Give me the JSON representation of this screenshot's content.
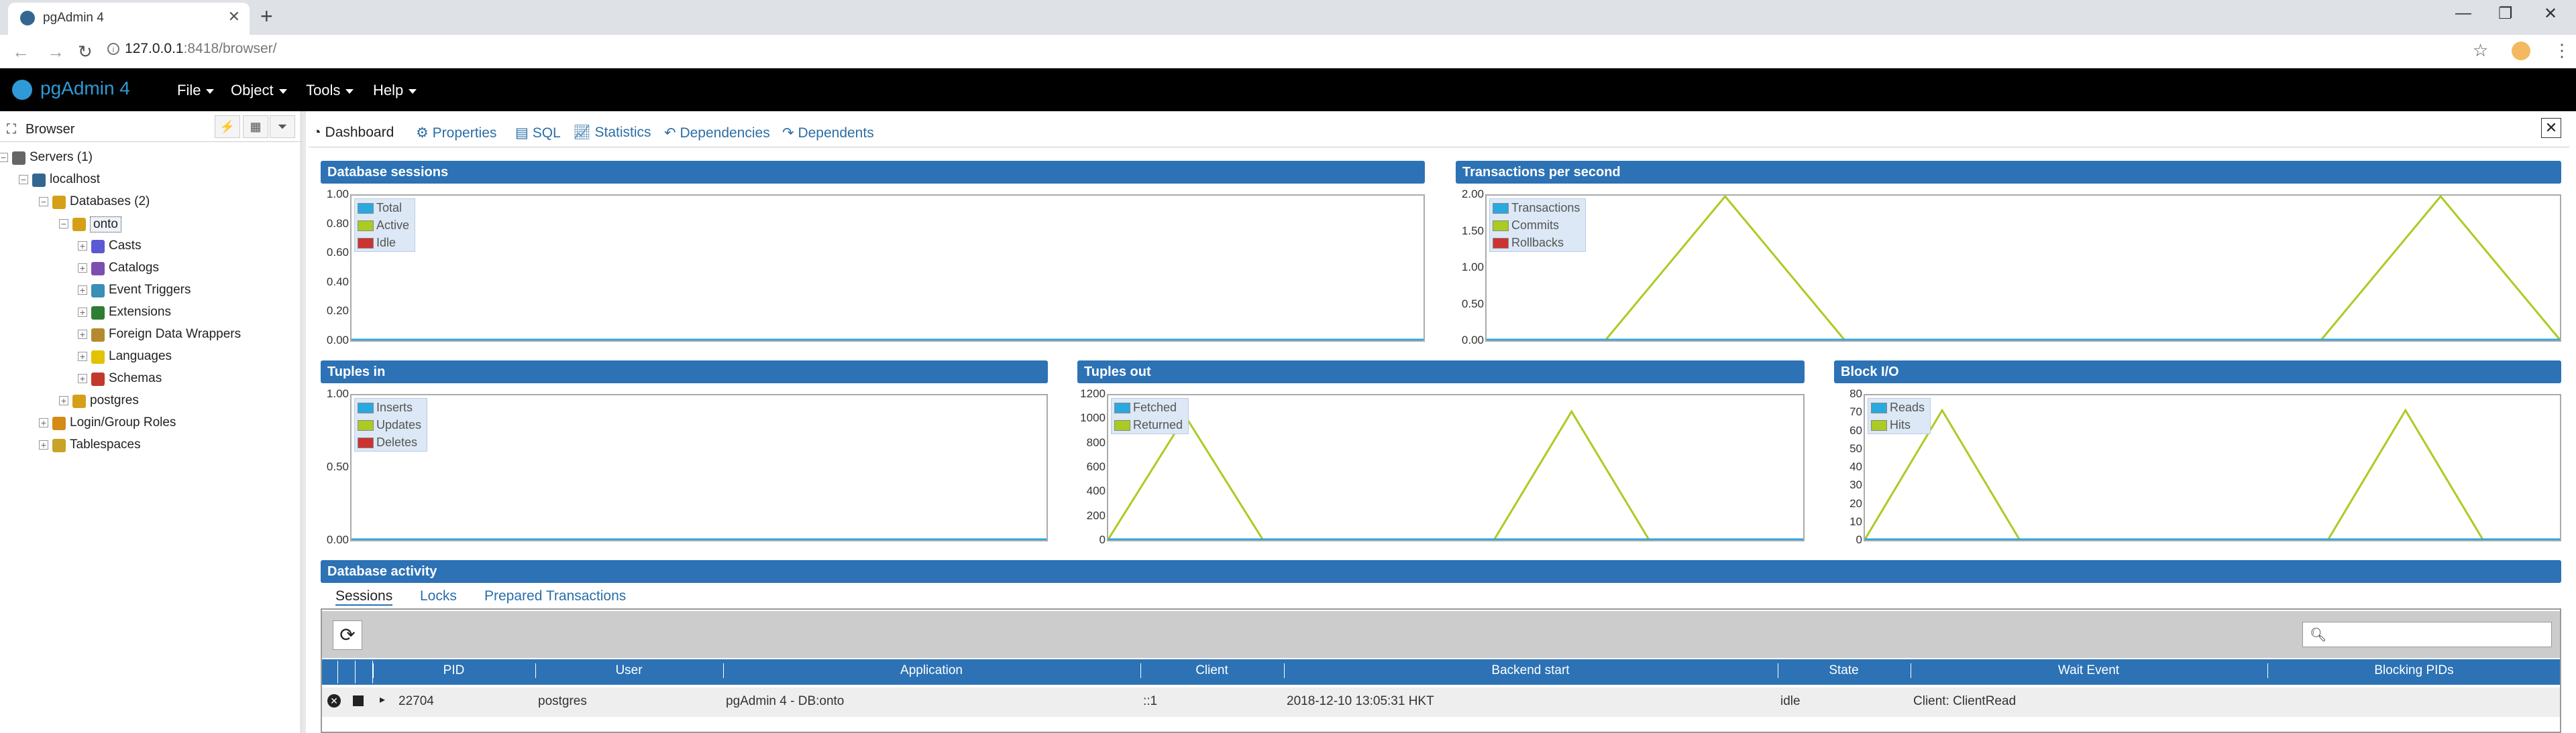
{
  "browser": {
    "tab_title": "pgAdmin 4",
    "url_host": "127.0.0.1",
    "url_rest": ":8418/browser/"
  },
  "app": {
    "brand": "pgAdmin 4",
    "menus": [
      "File",
      "Object",
      "Tools",
      "Help"
    ]
  },
  "left_panel": {
    "title": "Browser",
    "tree": [
      {
        "label": "Servers (1)",
        "icon": "servers-icon"
      },
      {
        "label": "localhost",
        "icon": "server-icon"
      },
      {
        "label": "Databases (2)",
        "icon": "databases-icon"
      },
      {
        "label": "onto",
        "icon": "database-icon"
      },
      {
        "label": "Casts",
        "icon": "casts-icon"
      },
      {
        "label": "Catalogs",
        "icon": "catalogs-icon"
      },
      {
        "label": "Event Triggers",
        "icon": "event-triggers-icon"
      },
      {
        "label": "Extensions",
        "icon": "extensions-icon"
      },
      {
        "label": "Foreign Data Wrappers",
        "icon": "fdw-icon"
      },
      {
        "label": "Languages",
        "icon": "languages-icon"
      },
      {
        "label": "Schemas",
        "icon": "schemas-icon"
      },
      {
        "label": "postgres",
        "icon": "database-icon"
      },
      {
        "label": "Login/Group Roles",
        "icon": "roles-icon"
      },
      {
        "label": "Tablespaces",
        "icon": "tablespaces-icon"
      }
    ]
  },
  "tabs": [
    "Dashboard",
    "Properties",
    "SQL",
    "Statistics",
    "Dependencies",
    "Dependents"
  ],
  "colors": {
    "header_blue": "#2c72b5",
    "series_blue": "#29a9e0",
    "series_green": "#aacc22",
    "series_red": "#cc3333"
  },
  "chart_data": [
    {
      "type": "line",
      "title": "Database sessions",
      "ylim": [
        0,
        1
      ],
      "ticks": [
        "1.00",
        "0.80",
        "0.60",
        "0.40",
        "0.20",
        "0.00"
      ],
      "series": [
        {
          "name": "Total",
          "values": [
            0,
            0,
            0,
            0,
            0,
            0,
            0,
            0,
            0,
            0
          ]
        },
        {
          "name": "Active",
          "values": [
            0,
            0,
            0,
            0,
            0,
            0,
            0,
            0,
            0,
            0
          ]
        },
        {
          "name": "Idle",
          "values": [
            0,
            0,
            0,
            0,
            0,
            0,
            0,
            0,
            0,
            0
          ]
        }
      ]
    },
    {
      "type": "line",
      "title": "Transactions per second",
      "ylim": [
        0,
        2
      ],
      "ticks": [
        "2.00",
        "1.50",
        "1.00",
        "0.50",
        "0.00"
      ],
      "series": [
        {
          "name": "Transactions",
          "values": [
            0,
            0,
            0,
            0,
            0,
            0,
            0,
            0,
            0,
            0
          ]
        },
        {
          "name": "Commits",
          "values": [
            0,
            0,
            2,
            0,
            0,
            0,
            0,
            0,
            2,
            0
          ]
        },
        {
          "name": "Rollbacks",
          "values": [
            0,
            0,
            0,
            0,
            0,
            0,
            0,
            0,
            0,
            0
          ]
        }
      ]
    },
    {
      "type": "line",
      "title": "Tuples in",
      "ylim": [
        0,
        1
      ],
      "ticks": [
        "1.00",
        "0.50",
        "0.00"
      ],
      "series": [
        {
          "name": "Inserts",
          "values": [
            0,
            0,
            0,
            0,
            0,
            0,
            0,
            0,
            0,
            0
          ]
        },
        {
          "name": "Updates",
          "values": [
            0,
            0,
            0,
            0,
            0,
            0,
            0,
            0,
            0,
            0
          ]
        },
        {
          "name": "Deletes",
          "values": [
            0,
            0,
            0,
            0,
            0,
            0,
            0,
            0,
            0,
            0
          ]
        }
      ]
    },
    {
      "type": "line",
      "title": "Tuples out",
      "ylim": [
        0,
        1200
      ],
      "ticks": [
        "1200",
        "1000",
        "800",
        "600",
        "400",
        "200",
        "0"
      ],
      "series": [
        {
          "name": "Fetched",
          "values": [
            0,
            0,
            0,
            0,
            0,
            0,
            0,
            0,
            0,
            0
          ]
        },
        {
          "name": "Returned",
          "values": [
            0,
            1030,
            0,
            0,
            0,
            0,
            1070,
            0,
            0,
            0
          ]
        }
      ]
    },
    {
      "type": "line",
      "title": "Block I/O",
      "ylim": [
        0,
        80
      ],
      "ticks": [
        "80",
        "70",
        "60",
        "50",
        "40",
        "30",
        "20",
        "10",
        "0"
      ],
      "series": [
        {
          "name": "Reads",
          "values": [
            0,
            0,
            0,
            0,
            0,
            0,
            0,
            0,
            0,
            0
          ]
        },
        {
          "name": "Hits",
          "values": [
            0,
            72,
            0,
            0,
            0,
            0,
            0,
            72,
            0,
            0
          ]
        }
      ]
    }
  ],
  "activity": {
    "title": "Database activity",
    "subtabs": [
      "Sessions",
      "Locks",
      "Prepared Transactions"
    ],
    "columns": [
      "PID",
      "User",
      "Application",
      "Client",
      "Backend start",
      "State",
      "Wait Event",
      "Blocking PIDs"
    ],
    "rows": [
      {
        "pid": "22704",
        "user": "postgres",
        "application": "pgAdmin 4 - DB:onto",
        "client": "::1",
        "backend_start": "2018-12-10 13:05:31 HKT",
        "state": "idle",
        "wait_event": "Client: ClientRead",
        "blocking": ""
      }
    ]
  }
}
